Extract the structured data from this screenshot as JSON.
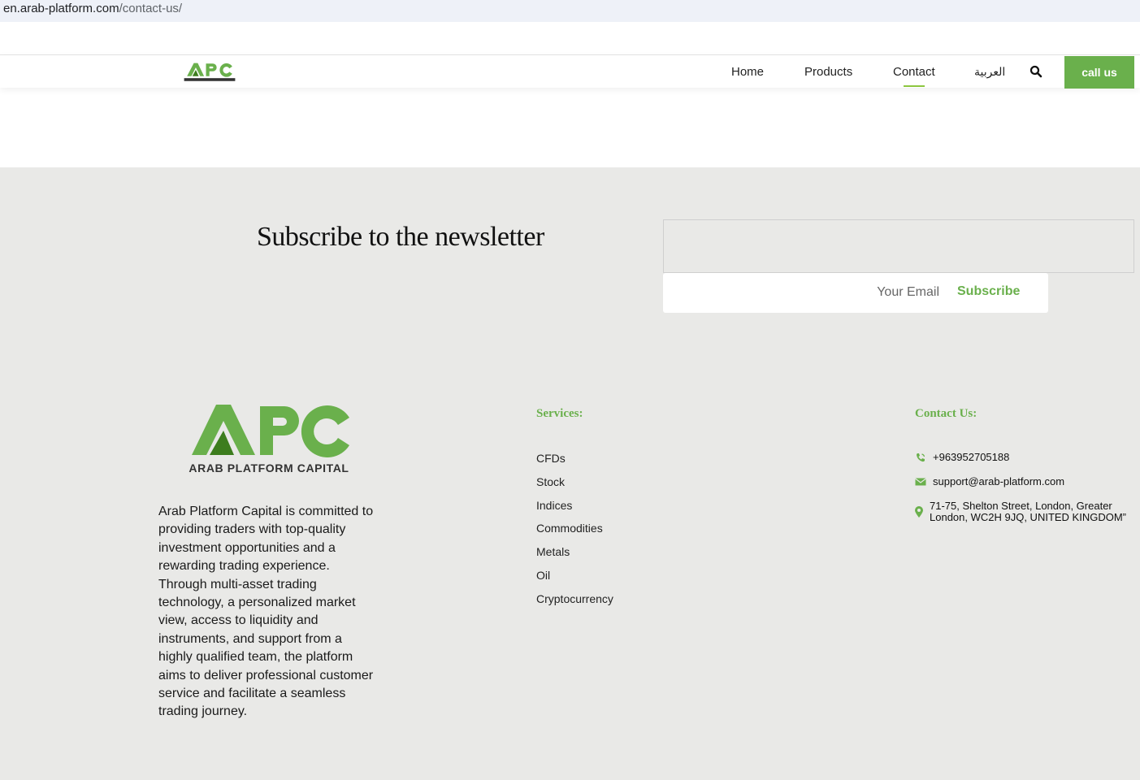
{
  "browser": {
    "url_host": "en.arab-platform.com",
    "url_path": "/contact-us/"
  },
  "header": {
    "logo_alt": "APC",
    "nav": {
      "home": "Home",
      "products": "Products",
      "contact": "Contact",
      "arabic": "العربية"
    },
    "call_us": "call us"
  },
  "newsletter": {
    "title": "Subscribe to the newsletter",
    "email_placeholder": "Your Email",
    "subscribe_label": "Subscribe"
  },
  "footer": {
    "logo_text": "APC",
    "logo_tagline": "ARAB PLATFORM CAPITAL",
    "about": "Arab Platform Capital is committed to providing traders with top-quality investment opportunities and a rewarding trading experience. Through multi-asset trading technology, a personalized market view, access to liquidity and instruments, and support from a highly qualified team, the platform aims to deliver professional customer service and facilitate a seamless trading journey.",
    "services_title": "Services:",
    "services": [
      "CFDs",
      "Stock",
      "Indices",
      "Commodities",
      "Metals",
      "Oil",
      "Cryptocurrency"
    ],
    "contact_title": "Contact Us:",
    "phone": "+963952705188",
    "email": "support@arab-platform.com",
    "address_line1": "71-75, Shelton Street, London, Greater",
    "address_line2": "London, WC2H 9JQ, UNITED KINGDOM”"
  },
  "colors": {
    "accent": "#6ab04c",
    "footer_bg": "#e9e9e7"
  }
}
